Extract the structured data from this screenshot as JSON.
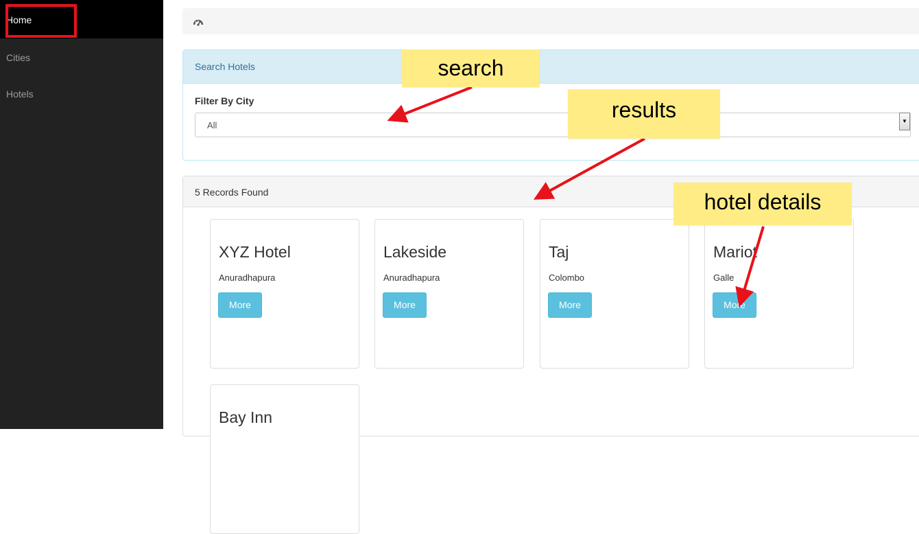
{
  "sidebar": {
    "items": [
      {
        "label": "Home"
      },
      {
        "label": "Cities"
      },
      {
        "label": "Hotels"
      }
    ]
  },
  "breadcrumb": {
    "icon": "dashboard-icon"
  },
  "search": {
    "heading": "Search Hotels",
    "filter_label": "Filter By City",
    "selected_city": "All"
  },
  "results": {
    "heading": "5 Records Found",
    "hotels": [
      {
        "name": "XYZ Hotel",
        "city": "Anuradhapura",
        "button": "More"
      },
      {
        "name": "Lakeside",
        "city": "Anuradhapura",
        "button": "More"
      },
      {
        "name": "Taj",
        "city": "Colombo",
        "button": "More"
      },
      {
        "name": "Mariot",
        "city": "Galle",
        "button": "More"
      },
      {
        "name": "Bay Inn"
      }
    ]
  },
  "annotations": {
    "search": "search",
    "results": "results",
    "details": "hotel details"
  },
  "colors": {
    "sidebar": "#222222",
    "info_button": "#5bc0de",
    "callout": "#ffec85",
    "arrow": "#e8121b"
  }
}
